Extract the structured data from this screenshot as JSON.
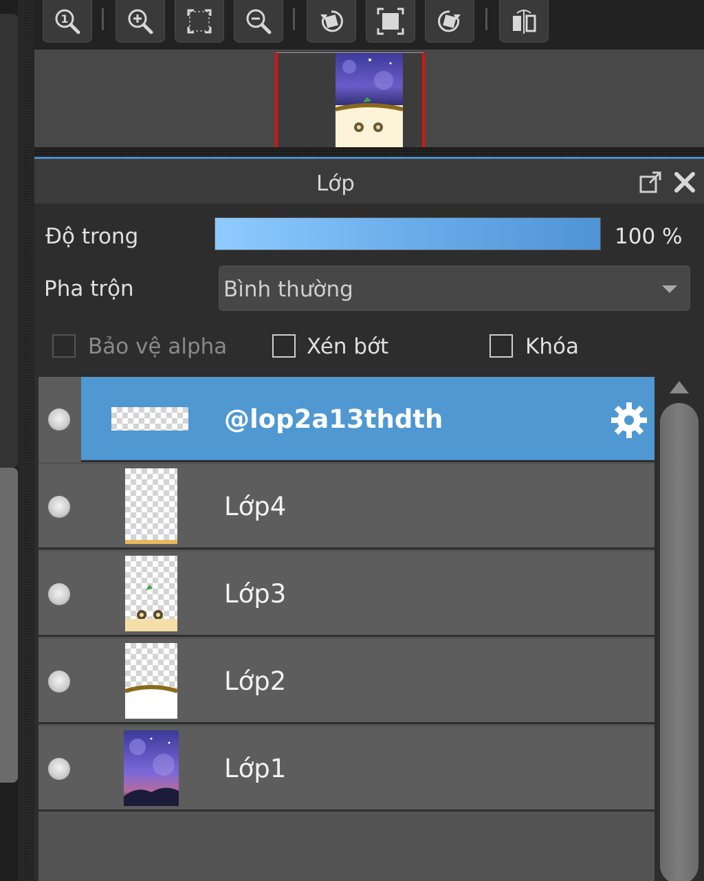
{
  "toolbar": {
    "buttons": [
      {
        "name": "zoom-actual-size-icon"
      },
      {
        "name": "zoom-in-icon"
      },
      {
        "name": "fit-to-window-icon"
      },
      {
        "name": "zoom-out-icon"
      },
      {
        "name": "rotate-left-icon"
      },
      {
        "name": "reset-rotation-icon"
      },
      {
        "name": "rotate-right-icon"
      },
      {
        "name": "flip-horizontal-icon"
      }
    ]
  },
  "panel": {
    "title": "Lớp",
    "popout_icon": "popout-icon",
    "close_icon": "close-icon"
  },
  "opacity": {
    "label": "Độ trong",
    "value": 100,
    "value_text": "100 %"
  },
  "blend": {
    "label": "Pha trộn",
    "selected": "Bình thường"
  },
  "options": {
    "protect_alpha": {
      "label": "Bảo vệ alpha",
      "checked": false,
      "enabled": false
    },
    "clipping": {
      "label": "Xén bớt",
      "checked": false,
      "enabled": true
    },
    "lock": {
      "label": "Khóa",
      "checked": false,
      "enabled": true
    }
  },
  "layers": [
    {
      "name": "@lop2a13thdth",
      "selected": true,
      "visible": true,
      "thumb": "text-strip"
    },
    {
      "name": "Lớp4",
      "selected": false,
      "visible": true,
      "thumb": "transparent"
    },
    {
      "name": "Lớp3",
      "selected": false,
      "visible": true,
      "thumb": "character"
    },
    {
      "name": "Lớp2",
      "selected": false,
      "visible": true,
      "thumb": "ground"
    },
    {
      "name": "Lớp1",
      "selected": false,
      "visible": true,
      "thumb": "night-sky"
    }
  ],
  "colors": {
    "accent": "#4f98d2",
    "selected_row": "#4f98d2",
    "frame_red": "#e01010"
  }
}
